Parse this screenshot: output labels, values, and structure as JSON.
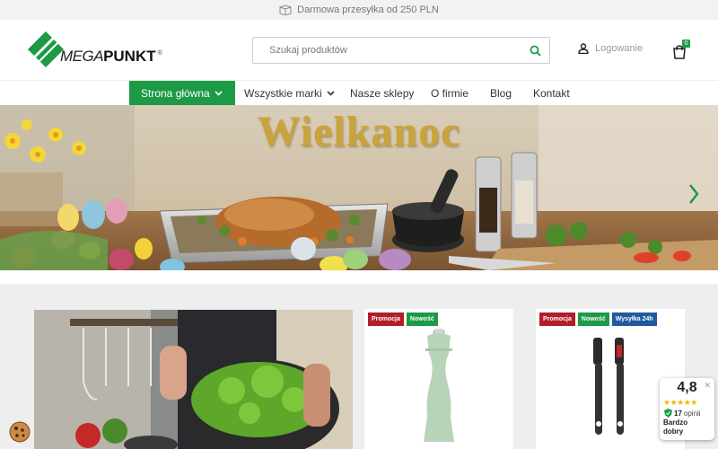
{
  "topbar": {
    "shipping_text": "Darmowa przesyłka od 250 PLN",
    "icon": "box-icon"
  },
  "header": {
    "logo": {
      "mega": "MEGA",
      "punkt": "PUNKT",
      "mark": "®"
    },
    "search": {
      "placeholder": "Szukaj produktów",
      "value": "",
      "icon": "search-icon"
    },
    "login_label": "Logowanie",
    "cart_count": "0"
  },
  "nav": {
    "items": [
      {
        "label": "Strona główna",
        "dropdown": true,
        "active": true
      },
      {
        "label": "Wszystkie marki",
        "dropdown": true
      },
      {
        "label": "Nasze sklepy"
      },
      {
        "label": "O firmie"
      },
      {
        "label": "Blog"
      },
      {
        "label": "Kontakt"
      }
    ]
  },
  "banner": {
    "title": "Wielkanoc",
    "next_icon": "chevron-right-icon"
  },
  "products": [
    {
      "badges": [
        "Promocja",
        "Nowość"
      ]
    },
    {
      "badges": [
        "Promocja",
        "Nowość",
        "Wysyłka 24h"
      ]
    }
  ],
  "rating": {
    "score": "4,8",
    "stars": "★★★★★",
    "count": "17",
    "count_label": "opinii",
    "verdict": "Bardzo dobry"
  },
  "colors": {
    "brand_green": "#1c9a45",
    "badge_red": "#b21d2b",
    "badge_blue": "#1f5a9c",
    "title_gold": "#c9a33b"
  }
}
